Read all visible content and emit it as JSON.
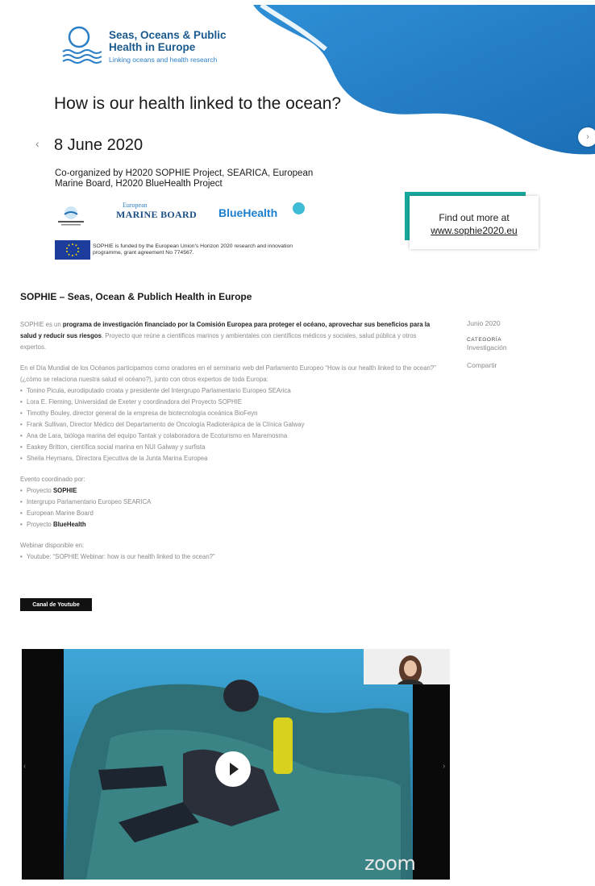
{
  "banner": {
    "logo_title_line1": "Seas, Oceans & Public",
    "logo_title_line2": "Health in Europe",
    "logo_subtitle": "Linking oceans and health research",
    "headline": "How is our health linked to the ocean?",
    "date": "8 June 2020",
    "coorganized": "Co-organized by H2020 SOPHIE Project, SEARICA, European Marine Board, H2020 BlueHealth Project",
    "sponsor_emb_top": "European",
    "sponsor_emb_main": "MARINE BOARD",
    "sponsor_bluehealth": "BlueHealth",
    "funding_note": "SOPHIE is funded by the European Union's Horizon 2020 research and innovation programme, grant agreement No 774567.",
    "findout_line1": "Find out more at",
    "findout_line2": "www.sophie2020.eu",
    "colors": {
      "accent": "#18a99d",
      "wave": "#2b7fc7",
      "title": "#1b5a8e"
    }
  },
  "post": {
    "title": "SOPHIE – Seas, Ocean & Publich Health in Europe",
    "p1_a": "SOPHIE es un ",
    "p1_b": "programa de investigación financiado por la Comisión Europea para proteger el océano, aprovechar sus beneficios para la salud y reducir sus riesgos",
    "p1_c": ". Proyecto que reúne a científicos marinos y ambientales con científicos médicos y sociales, salud pública y otros expertos.",
    "p2": "En el Día Mundial de los Océanos participamos como oradores en el seminario web del Parlamento Europeo “How is our health linked to the ocean?” (¿cómo se relaciona nuestra salud el océano?), junto con otros expertos de toda Europa:",
    "speakers": [
      "Tonino Picula, eurodiputado croata y presidente del Intergrupo Parlamentario Europeo SEArica",
      "Lora E. Fleming, Universidad de Exeter y coordinadora del Proyecto SOPHIE",
      "Timothy Bouley, director general de la empresa de biotecnología oceánica BioFeyn",
      "Frank Sullivan, Director Médico del Departamento de Oncología Radioterápica de la Clínica Galway",
      "Ana de Lara, bióloga marina del equipo Tantak y colaboradora de Ecoturismo en Maremosma",
      "Easkey Britton, científica social marina en NUI Galway y surfista",
      "Sheila Heymans, Directora Ejecutiva de la Junta Marina Europea"
    ],
    "coord_label": "Evento coordinado por:",
    "coordinators": [
      {
        "pre": "Proyecto ",
        "bold": "SOPHIE"
      },
      {
        "pre": "Intergrupo Parlamentario Europeo SEARICA",
        "bold": ""
      },
      {
        "pre": "European Marine Board",
        "bold": ""
      },
      {
        "pre": "Proyecto ",
        "bold": "BlueHealth"
      }
    ],
    "webinar_label": "Webinar disponible en:",
    "webinar_link": "Youtube: “SOPHIE Webinar: how is our health linked to the ocean?”",
    "button": "Canal de Youtube"
  },
  "sidebar": {
    "date": "Junio 2020",
    "category_label": "CATEGORÍA",
    "category": "Investigación",
    "share": "Compartir"
  },
  "video": {
    "watermark": "zoom"
  }
}
